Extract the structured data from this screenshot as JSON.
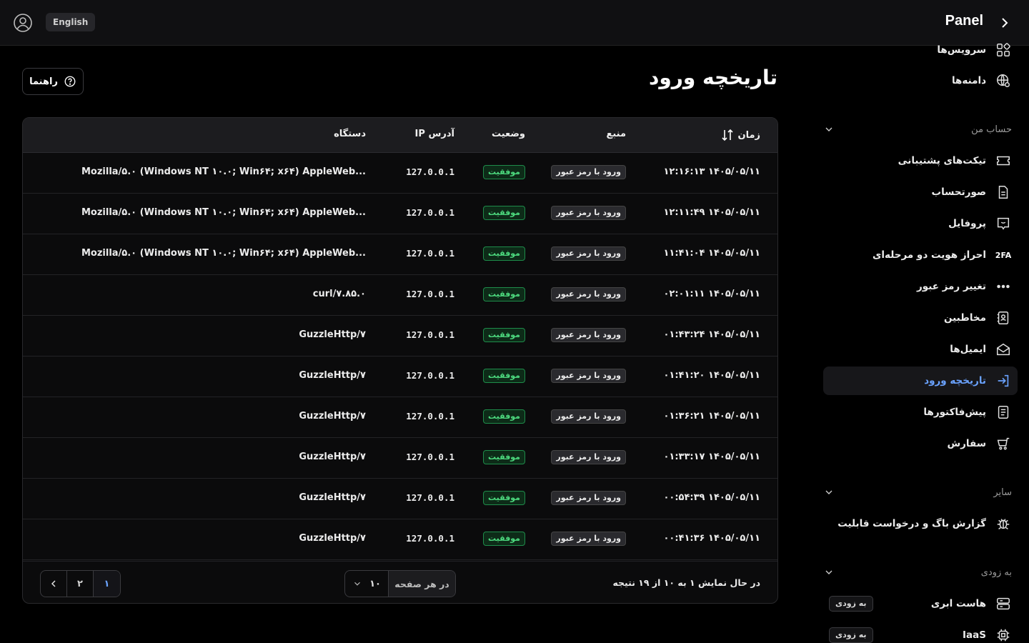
{
  "topbar": {
    "brand": "Panel",
    "lang_label": "English"
  },
  "sidebar": {
    "items_top": [
      {
        "label": "سرویس‌ها",
        "icon": "services-icon"
      },
      {
        "label": "دامنه‌ها",
        "icon": "globe-icon"
      }
    ],
    "section_account": "حساب من",
    "account_items": [
      {
        "label": "تیکت‌های پشتیبانی",
        "icon": "ticket-icon"
      },
      {
        "label": "صورتحساب",
        "icon": "invoice-icon"
      },
      {
        "label": "پروفایل",
        "icon": "profile-icon"
      },
      {
        "label": "احراز هویت دو مرحله‌ای",
        "icon": "2fa-icon",
        "icon_text": "2FA"
      },
      {
        "label": "تغییر رمز عبور",
        "icon": "password-dots-icon"
      },
      {
        "label": "مخاطبین",
        "icon": "contacts-icon"
      },
      {
        "label": "ایمیل‌ها",
        "icon": "mail-icon"
      },
      {
        "label": "تاریخچه ورود",
        "icon": "login-icon",
        "active": true
      },
      {
        "label": "پیش‌فاکتورها",
        "icon": "proforma-icon"
      },
      {
        "label": "سفارش",
        "icon": "cart-icon"
      }
    ],
    "section_other": "سایر",
    "other_items": [
      {
        "label": "گزارش باگ و درخواست قابلیت",
        "icon": "bug-icon"
      }
    ],
    "section_soon": "به زودی",
    "soon_items": [
      {
        "label": "هاست ابری",
        "icon": "server-icon",
        "badge": "به زودی"
      },
      {
        "label": "IaaS",
        "icon": "chip-icon",
        "badge": "به زودی"
      }
    ]
  },
  "main": {
    "title": "تاریخچه ورود",
    "help_label": "راهنما",
    "table": {
      "headers": {
        "time": "زمان",
        "source": "منبع",
        "status": "وضعیت",
        "ip": "آدرس IP",
        "device": "دستگاه"
      },
      "rows": [
        {
          "time": "۱۴۰۵/۰۵/۱۱ ۱۲:۱۶:۱۳",
          "source": "ورود با رمز عبور",
          "status": "موفقیت",
          "ip": "127.0.0.1",
          "device": "Mozilla/۵.۰ (Windows NT ۱۰.۰; Win۶۴; x۶۴) AppleWeb..."
        },
        {
          "time": "۱۴۰۵/۰۵/۱۱ ۱۲:۱۱:۴۹",
          "source": "ورود با رمز عبور",
          "status": "موفقیت",
          "ip": "127.0.0.1",
          "device": "Mozilla/۵.۰ (Windows NT ۱۰.۰; Win۶۴; x۶۴) AppleWeb..."
        },
        {
          "time": "۱۴۰۵/۰۵/۱۱ ۱۱:۴۱:۰۴",
          "source": "ورود با رمز عبور",
          "status": "موفقیت",
          "ip": "127.0.0.1",
          "device": "Mozilla/۵.۰ (Windows NT ۱۰.۰; Win۶۴; x۶۴) AppleWeb..."
        },
        {
          "time": "۱۴۰۵/۰۵/۱۱ ۰۲:۰۱:۱۱",
          "source": "ورود با رمز عبور",
          "status": "موفقیت",
          "ip": "127.0.0.1",
          "device": "curl/۷.۸۵.۰"
        },
        {
          "time": "۱۴۰۵/۰۵/۱۱ ۰۱:۴۳:۲۴",
          "source": "ورود با رمز عبور",
          "status": "موفقیت",
          "ip": "127.0.0.1",
          "device": "GuzzleHttp/۷"
        },
        {
          "time": "۱۴۰۵/۰۵/۱۱ ۰۱:۴۱:۲۰",
          "source": "ورود با رمز عبور",
          "status": "موفقیت",
          "ip": "127.0.0.1",
          "device": "GuzzleHttp/۷"
        },
        {
          "time": "۱۴۰۵/۰۵/۱۱ ۰۱:۳۶:۲۱",
          "source": "ورود با رمز عبور",
          "status": "موفقیت",
          "ip": "127.0.0.1",
          "device": "GuzzleHttp/۷"
        },
        {
          "time": "۱۴۰۵/۰۵/۱۱ ۰۱:۳۳:۱۷",
          "source": "ورود با رمز عبور",
          "status": "موفقیت",
          "ip": "127.0.0.1",
          "device": "GuzzleHttp/۷"
        },
        {
          "time": "۱۴۰۵/۰۵/۱۱ ۰۰:۵۴:۳۹",
          "source": "ورود با رمز عبور",
          "status": "موفقیت",
          "ip": "127.0.0.1",
          "device": "GuzzleHttp/۷"
        },
        {
          "time": "۱۴۰۵/۰۵/۱۱ ۰۰:۴۱:۳۶",
          "source": "ورود با رمز عبور",
          "status": "موفقیت",
          "ip": "127.0.0.1",
          "device": "GuzzleHttp/۷"
        }
      ]
    },
    "footer": {
      "result_text": "در حال نمایش ۱ به ۱۰ از ۱۹ نتیجه",
      "per_page_label": "در هر صفحه",
      "per_page_value": "۱۰",
      "pages": [
        "۱",
        "۲"
      ],
      "current_page": "۱"
    }
  },
  "colors": {
    "accent": "#6aa2ff",
    "success": "#4ddb7f",
    "background": "#000000"
  }
}
